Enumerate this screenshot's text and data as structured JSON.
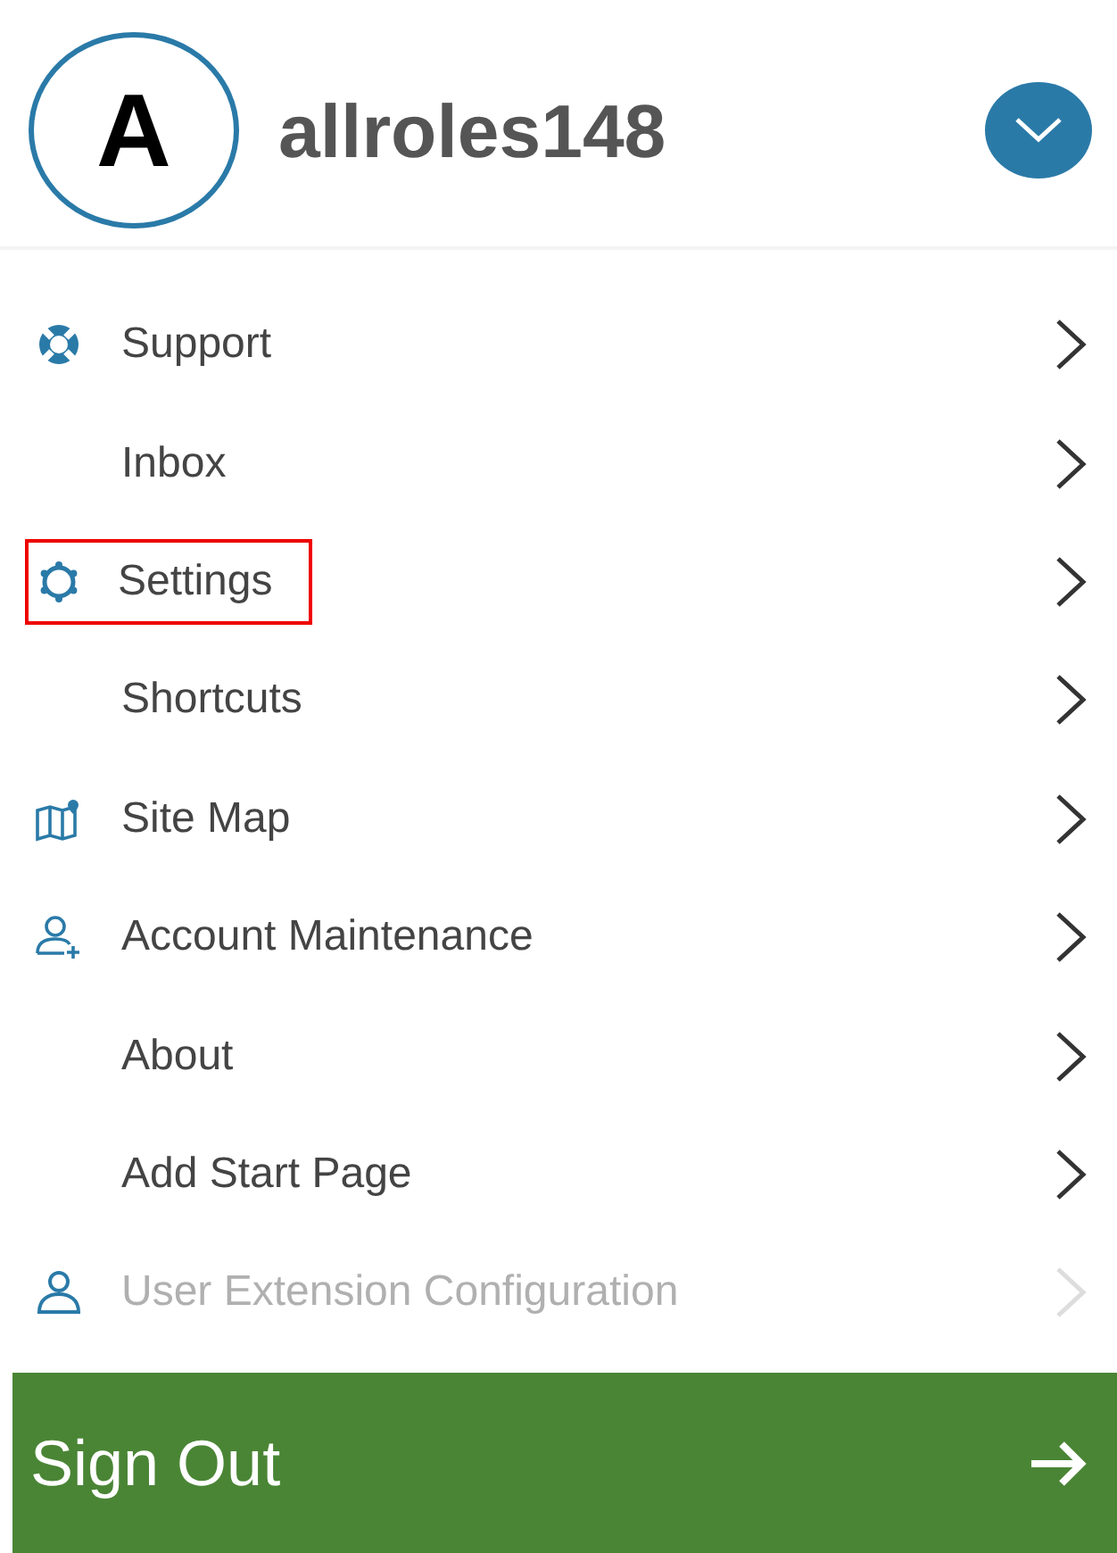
{
  "user": {
    "initial": "A",
    "name": "allroles148"
  },
  "menu": [
    {
      "label": "Support",
      "kind": "lifebuoy",
      "disabled": false,
      "highlighted": false
    },
    {
      "label": "Inbox",
      "kind": "plain",
      "disabled": false,
      "highlighted": false
    },
    {
      "label": "Settings",
      "kind": "gear",
      "disabled": false,
      "highlighted": true
    },
    {
      "label": "Shortcuts",
      "kind": "plain",
      "disabled": false,
      "highlighted": false
    },
    {
      "label": "Site Map",
      "kind": "map",
      "disabled": false,
      "highlighted": false
    },
    {
      "label": "Account Maintenance",
      "kind": "useradd",
      "disabled": false,
      "highlighted": false
    },
    {
      "label": "About",
      "kind": "plain",
      "disabled": false,
      "highlighted": false
    },
    {
      "label": "Add Start Page",
      "kind": "plain",
      "disabled": false,
      "highlighted": false
    },
    {
      "label": "User Extension Configuration",
      "kind": "user",
      "disabled": true,
      "highlighted": false
    }
  ],
  "sign_out": {
    "label": "Sign Out"
  }
}
